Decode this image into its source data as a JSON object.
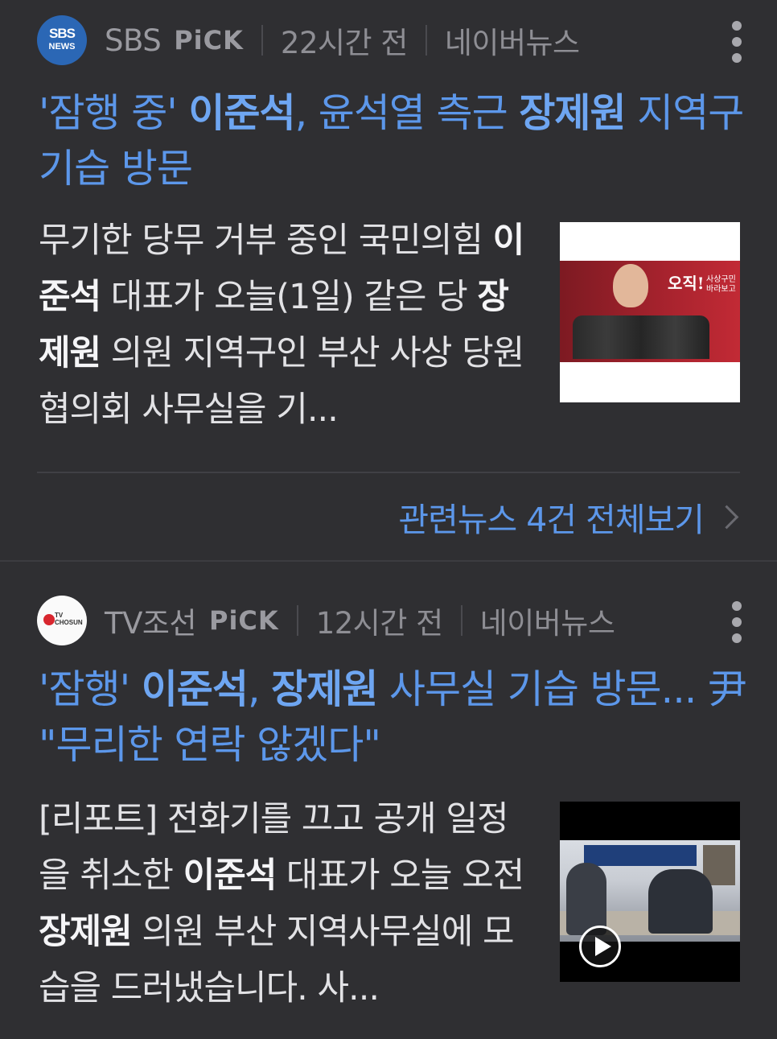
{
  "articles": [
    {
      "source": "SBS",
      "logo_text_1": "SBS",
      "logo_text_2": "NEWS",
      "pick": "PiCK",
      "time": "22시간 전",
      "portal": "네이버뉴스",
      "headline_parts": [
        "'잠행 중' ",
        "이준석",
        ", 윤석열 측근 ",
        "장제원",
        " 지역구 기습 방문"
      ],
      "summary_parts": [
        "무기한 당무 거부 중인 국민의힘 ",
        "이준석",
        " 대표가 오늘(1일) 같은 당 ",
        "장제원",
        " 의원 지역구인 부산 사상 당원협의회 사무실을 기..."
      ],
      "thumb_text": "오직!",
      "thumb_text_2": "사상구민 바라보고",
      "related": "관련뉴스 4건 전체보기"
    },
    {
      "source": "TV조선",
      "logo_text_1": "TV CHOSUN",
      "pick": "PiCK",
      "time": "12시간 전",
      "portal": "네이버뉴스",
      "headline_parts": [
        "'잠행' ",
        "이준석",
        ", ",
        "장제원",
        " 사무실 기습 방문... 尹 \"무리한 연락 않겠다\""
      ],
      "summary_parts": [
        "[리포트] 전화기를 끄고 공개 일정을 취소한 ",
        "이준석",
        " 대표가 오늘 오전 ",
        "장제원",
        " 의원 부산 지역사무실에 모습을 드러냈습니다. 사..."
      ]
    }
  ]
}
